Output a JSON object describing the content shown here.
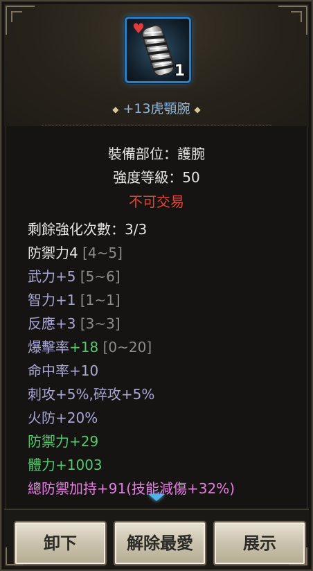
{
  "item": {
    "count": "1",
    "name": "+13虎顎腕",
    "slot": "裝備部位：護腕",
    "grade": "強度等級：50",
    "trade": "不可交易"
  },
  "stats": [
    {
      "main": "剩餘強化次數：3/3",
      "extra": "",
      "range": "",
      "color": "white"
    },
    {
      "main": "防禦力4",
      "extra": "",
      "range": "[4~5]",
      "color": "white"
    },
    {
      "main": "武力+5",
      "extra": "",
      "range": "[5~6]",
      "color": "lav"
    },
    {
      "main": "智力+1",
      "extra": "",
      "range": "[1~1]",
      "color": "lav"
    },
    {
      "main": "反應+3",
      "extra": "",
      "range": "[3~3]",
      "color": "lav"
    },
    {
      "main": "爆擊率",
      "extra": "+18",
      "range": "[0~20]",
      "color": "lav"
    },
    {
      "main": "命中率+10",
      "extra": "",
      "range": "",
      "color": "lav"
    },
    {
      "main": "刺攻+5%,碎攻+5%",
      "extra": "",
      "range": "",
      "color": "lav"
    },
    {
      "main": "火防+20%",
      "extra": "",
      "range": "",
      "color": "lav"
    },
    {
      "main": "防禦力+29",
      "extra": "",
      "range": "",
      "color": "green"
    },
    {
      "main": "體力+1003",
      "extra": "",
      "range": "",
      "color": "green"
    },
    {
      "main": "總防禦加持+91(技能減傷+32%)",
      "extra": "",
      "range": "",
      "color": "pink"
    }
  ],
  "buttons": {
    "unequip": "卸下",
    "unfavorite": "解除最愛",
    "show": "展示"
  },
  "colors": {
    "name_blue": "#8fb7df",
    "untradeable_red": "#e0443a",
    "stat_lavender": "#a9a7d6",
    "stat_green": "#54c970",
    "stat_pink": "#e57fe3",
    "icon_border": "#2d7fc4"
  },
  "icons": {
    "favorite": "heart-icon",
    "item": "bracer-item-icon",
    "scroll": "scroll-down-arrow-icon"
  }
}
